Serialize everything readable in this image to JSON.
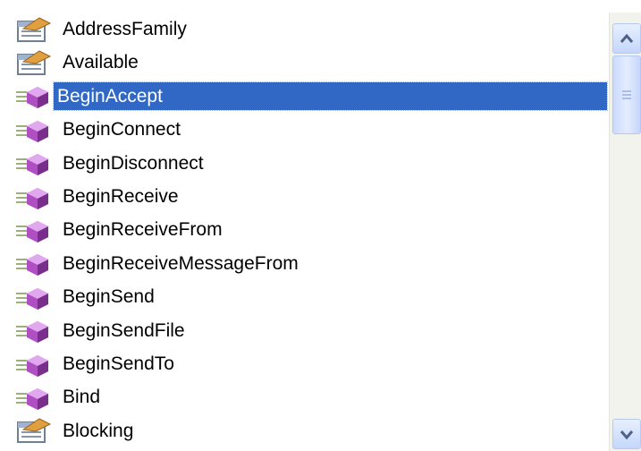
{
  "members": [
    {
      "name": "AddressFamily",
      "kind": "property-icon",
      "selected": false
    },
    {
      "name": "Available",
      "kind": "property-icon",
      "selected": false
    },
    {
      "name": "BeginAccept",
      "kind": "method-icon",
      "selected": true
    },
    {
      "name": "BeginConnect",
      "kind": "method-icon",
      "selected": false
    },
    {
      "name": "BeginDisconnect",
      "kind": "method-icon",
      "selected": false
    },
    {
      "name": "BeginReceive",
      "kind": "method-icon",
      "selected": false
    },
    {
      "name": "BeginReceiveFrom",
      "kind": "method-icon",
      "selected": false
    },
    {
      "name": "BeginReceiveMessageFrom",
      "kind": "method-icon",
      "selected": false
    },
    {
      "name": "BeginSend",
      "kind": "method-icon",
      "selected": false
    },
    {
      "name": "BeginSendFile",
      "kind": "method-icon",
      "selected": false
    },
    {
      "name": "BeginSendTo",
      "kind": "method-icon",
      "selected": false
    },
    {
      "name": "Bind",
      "kind": "method-icon",
      "selected": false
    },
    {
      "name": "Blocking",
      "kind": "property-icon",
      "selected": false
    }
  ],
  "scrollbar": {
    "up_icon": "chevron-up-icon",
    "down_icon": "chevron-down-icon"
  },
  "colors": {
    "selection": "#3168c6",
    "method_gem": "#b04fc4",
    "property_hand": "#e0a040"
  }
}
